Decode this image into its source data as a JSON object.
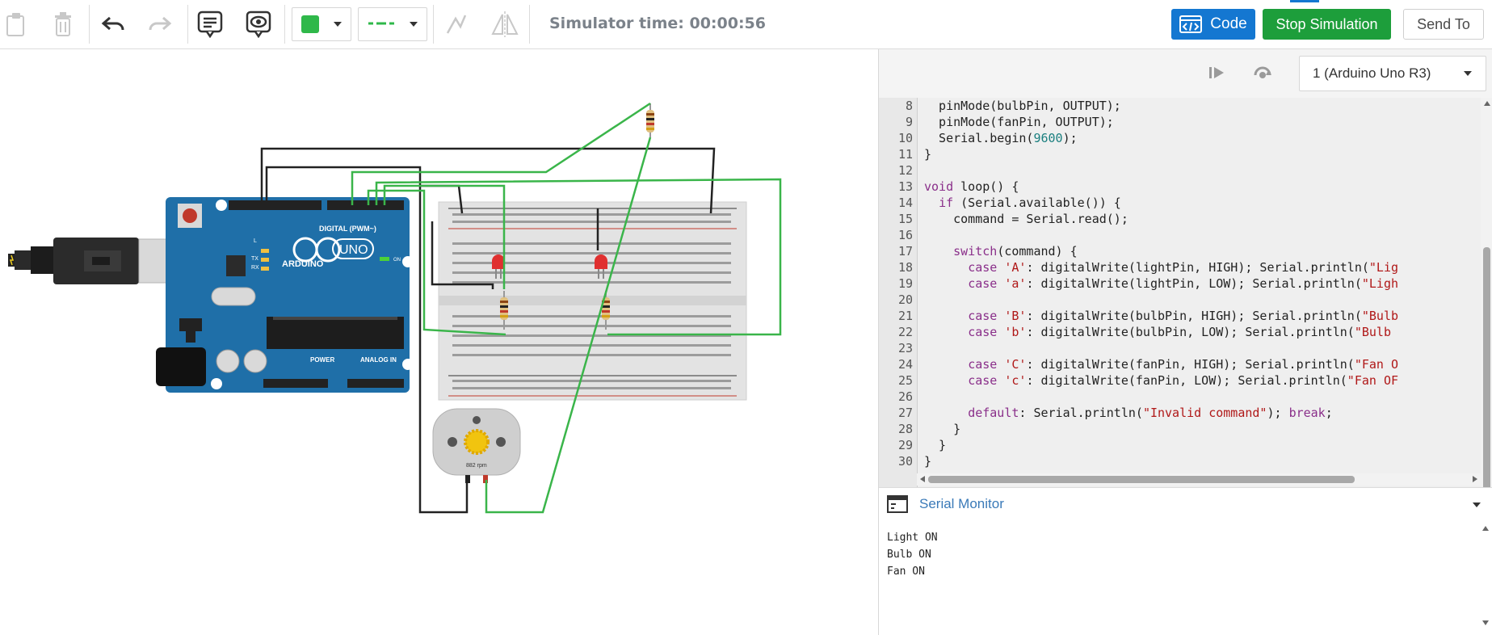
{
  "toolbar": {
    "simulator_time": "Simulator time: 00:00:56",
    "code_label": "Code",
    "stop_label": "Stop Simulation",
    "send_label": "Send To",
    "fill_color": "#2fb84a"
  },
  "code_panel": {
    "device_select": "1 (Arduino Uno R3)",
    "line_numbers": [
      "8",
      "9",
      "10",
      "11",
      "12",
      "13",
      "14",
      "15",
      "16",
      "17",
      "18",
      "19",
      "20",
      "21",
      "22",
      "23",
      "24",
      "25",
      "26",
      "27",
      "28",
      "29",
      "30"
    ]
  },
  "serial_monitor": {
    "title": "Serial Monitor",
    "lines": [
      "Light ON",
      "Bulb ON",
      "Fan ON"
    ]
  },
  "circuit": {
    "board_brand": "ARDUINO",
    "board_model": "UNO",
    "digital_label": "DIGITAL (PWM~)",
    "power_label": "POWER",
    "analog_label": "ANALOG IN",
    "motor_rpm": "882 rpm",
    "tx_label": "TX",
    "rx_label": "RX",
    "l_label": "L",
    "on_label": "ON"
  },
  "colors": {
    "accent_blue": "#1477d1",
    "stop_green": "#1d9e3b",
    "wire_green": "#3ab54a",
    "wire_black": "#222222",
    "board_blue": "#1f6fa8"
  }
}
